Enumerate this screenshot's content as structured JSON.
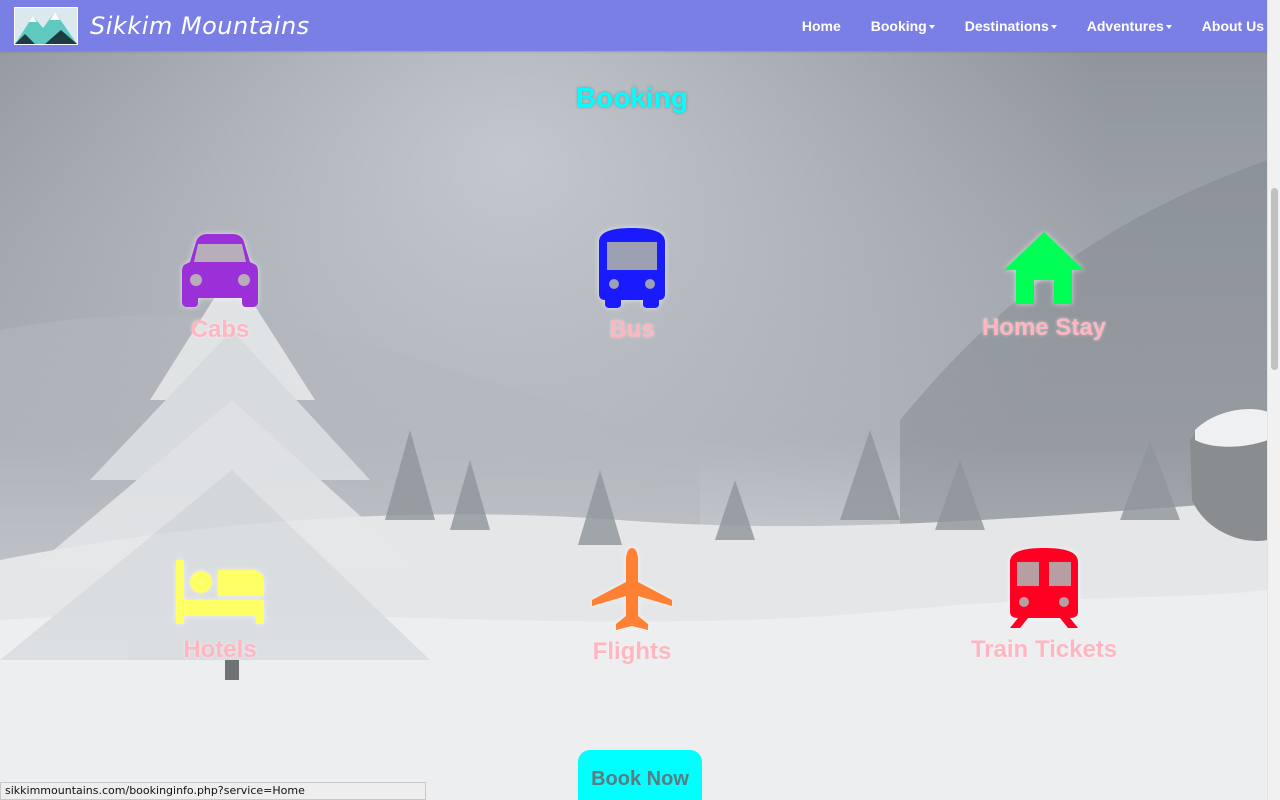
{
  "brand": {
    "name": "Sikkim Mountains"
  },
  "nav": {
    "items": [
      {
        "label": "Home",
        "dropdown": false
      },
      {
        "label": "Booking",
        "dropdown": true
      },
      {
        "label": "Destinations",
        "dropdown": true
      },
      {
        "label": "Adventures",
        "dropdown": true
      },
      {
        "label": "About Us",
        "dropdown": false
      }
    ]
  },
  "section": {
    "title": "Booking"
  },
  "services": [
    {
      "label": "Cabs",
      "icon": "car-icon",
      "color": "#9b30d9"
    },
    {
      "label": "Bus",
      "icon": "bus-icon",
      "color": "#1a1aff"
    },
    {
      "label": "Home Stay",
      "icon": "home-icon",
      "color": "#00ff55"
    },
    {
      "label": "Hotels",
      "icon": "bed-icon",
      "color": "#ffff66"
    },
    {
      "label": "Flights",
      "icon": "airplane-icon",
      "color": "#ff7f33"
    },
    {
      "label": "Train Tickets",
      "icon": "train-icon",
      "color": "#ff0022"
    }
  ],
  "cta": {
    "label": "Book Now"
  },
  "status_bar": {
    "url": "sikkimmountains.com/bookinginfo.php?service=Home"
  },
  "colors": {
    "navbar": "#7a7fe6",
    "title": "#00ffff",
    "labels": "#ffb6c1",
    "cta_bg": "#00ffff"
  }
}
